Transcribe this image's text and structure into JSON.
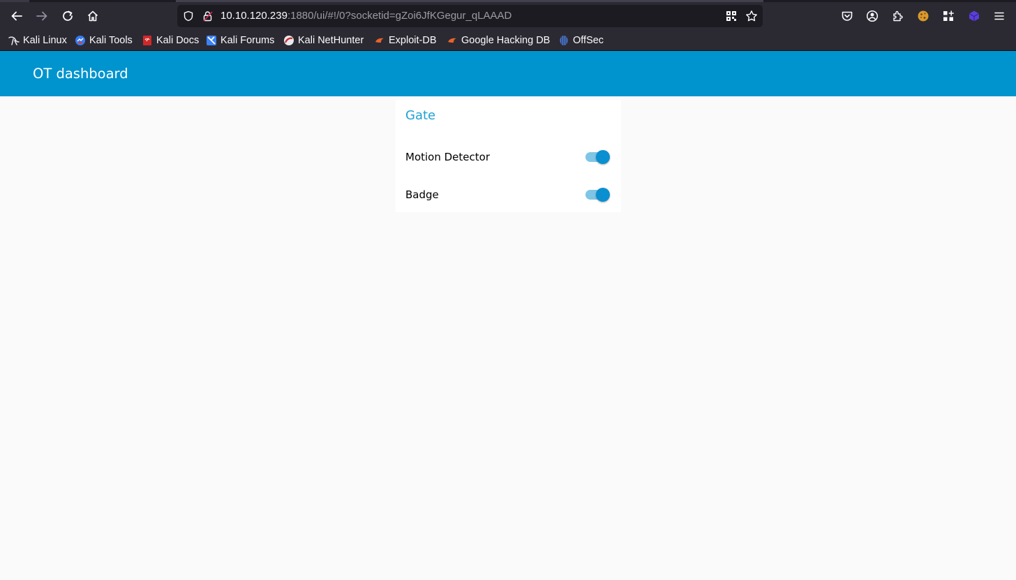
{
  "browser": {
    "url_host": "10.10.120.239",
    "url_rest": ":1880/ui/#!/0?socketid=gZoi6JfKGegur_qLAAAD",
    "nav_icons": [
      "back-icon",
      "forward-icon",
      "reload-icon",
      "home-icon"
    ],
    "toolbar_icons": [
      "pocket-icon",
      "account-icon",
      "extensions-icon",
      "cookie-icon",
      "grid-plus-icon",
      "extension-cube-icon",
      "menu-icon"
    ],
    "bookmarks": [
      {
        "label": "Kali Linux",
        "icon": "kali-dragon-icon"
      },
      {
        "label": "Kali Tools",
        "icon": "kali-tools-icon"
      },
      {
        "label": "Kali Docs",
        "icon": "kali-docs-icon"
      },
      {
        "label": "Kali Forums",
        "icon": "kali-forums-icon"
      },
      {
        "label": "Kali NetHunter",
        "icon": "kali-nethunter-icon"
      },
      {
        "label": "Exploit-DB",
        "icon": "exploit-db-icon"
      },
      {
        "label": "Google Hacking DB",
        "icon": "ghdb-icon"
      },
      {
        "label": "OffSec",
        "icon": "offsec-icon"
      }
    ]
  },
  "header": {
    "title": "OT dashboard",
    "color": "#0094ce"
  },
  "card": {
    "title": "Gate",
    "title_color": "#1fa1d4",
    "rows": [
      {
        "label": "Motion Detector",
        "on": true
      },
      {
        "label": "Badge",
        "on": true
      }
    ]
  }
}
